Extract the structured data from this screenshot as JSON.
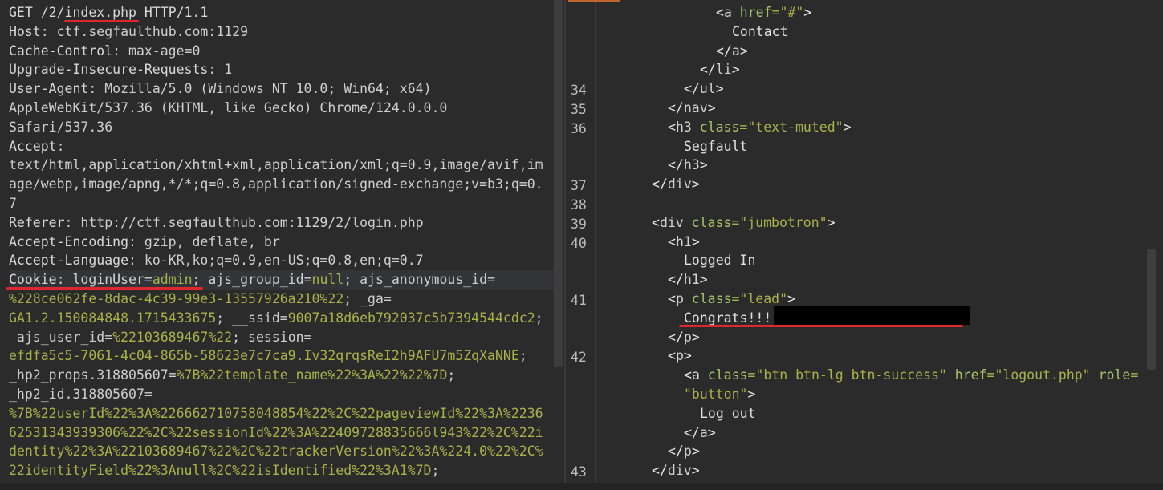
{
  "request": {
    "lines": [
      [
        {
          "t": "GET /2/",
          "c": "w"
        },
        {
          "t": "index.php",
          "c": "w"
        },
        {
          "t": " HTTP/1.1",
          "c": "w"
        }
      ],
      [
        {
          "t": "Host",
          "c": "k"
        },
        {
          "t": ": ctf.segfaulthub.com:1129",
          "c": "v"
        }
      ],
      [
        {
          "t": "Cache-Control",
          "c": "k"
        },
        {
          "t": ": max-age=0",
          "c": "v"
        }
      ],
      [
        {
          "t": "Upgrade-Insecure-Requests",
          "c": "k"
        },
        {
          "t": ": 1",
          "c": "v"
        }
      ],
      [
        {
          "t": "User-Agent",
          "c": "k"
        },
        {
          "t": ": Mozilla/5.0 (Windows NT 10.0; Win64; x64)",
          "c": "v"
        }
      ],
      [
        {
          "t": "AppleWebKit/537.36 (KHTML, like Gecko) Chrome/124.0.0.0",
          "c": "v"
        }
      ],
      [
        {
          "t": "Safari/537.36",
          "c": "v"
        }
      ],
      [
        {
          "t": "Accept",
          "c": "k"
        },
        {
          "t": ":",
          "c": "v"
        }
      ],
      [
        {
          "t": "text/html,application/xhtml+xml,application/xml;q=0.9,image/avif,im",
          "c": "v"
        }
      ],
      [
        {
          "t": "age/webp,image/apng,*/*;q=0.8,application/signed-exchange;v=b3;q=0.",
          "c": "v"
        }
      ],
      [
        {
          "t": "7",
          "c": "v"
        }
      ],
      [
        {
          "t": "Referer",
          "c": "k"
        },
        {
          "t": ": http://ctf.segfaulthub.com:1129/2/login.php",
          "c": "v"
        }
      ],
      [
        {
          "t": "Accept-Encoding",
          "c": "k"
        },
        {
          "t": ": gzip, deflate, br",
          "c": "v"
        }
      ],
      [
        {
          "t": "Accept-Language",
          "c": "k"
        },
        {
          "t": ": ko-KR,ko;q=0.9,en-US;q=0.8,en;q=0.7",
          "c": "v"
        }
      ],
      [
        {
          "t": "Cookie",
          "c": "k"
        },
        {
          "t": ": loginUser=",
          "c": "v"
        },
        {
          "t": "admin",
          "c": "g"
        },
        {
          "t": "; ajs_group_id=",
          "c": "v"
        },
        {
          "t": "null",
          "c": "g"
        },
        {
          "t": "; ajs_anonymous_id=",
          "c": "v"
        }
      ],
      [
        {
          "t": "%228ce062fe-8dac-4c39-99e3-13557926a210%22",
          "c": "g"
        },
        {
          "t": "; _ga=",
          "c": "v"
        }
      ],
      [
        {
          "t": "GA1.2.150084848.1715433675",
          "c": "g"
        },
        {
          "t": "; __ssid=",
          "c": "v"
        },
        {
          "t": "9007a18d6eb792037c5b7394544cdc2",
          "c": "g"
        },
        {
          "t": ";",
          "c": "v"
        }
      ],
      [
        {
          "t": " ajs_user_id=",
          "c": "v"
        },
        {
          "t": "%22103689467%22",
          "c": "g"
        },
        {
          "t": "; session=",
          "c": "v"
        }
      ],
      [
        {
          "t": "efdfa5c5-7061-4c04-865b-58623e7c7ca9.Iv32qrqsReI2h9AFU7m5ZqXaNNE",
          "c": "g"
        },
        {
          "t": ";",
          "c": "v"
        }
      ],
      [
        {
          "t": "_hp2_props.318805607=",
          "c": "v"
        },
        {
          "t": "%7B%22template_name%22%3A%22%22%7D",
          "c": "g"
        },
        {
          "t": ";",
          "c": "v"
        }
      ],
      [
        {
          "t": "_hp2_id.318805607=",
          "c": "v"
        }
      ],
      [
        {
          "t": "%7B%22userId%22%3A%226662710758048854%22%2C%22pageviewId%22%3A%2236",
          "c": "g"
        }
      ],
      [
        {
          "t": "62531343939306%22%2C%22sessionId%22%3A%22409728835666l943%22%2C%22i",
          "c": "g"
        }
      ],
      [
        {
          "t": "dentity%22%3A%22103689467%22%2C%22trackerVersion%22%3A%224.0%22%2C%",
          "c": "g"
        }
      ],
      [
        {
          "t": "22identityField%22%3Anull%2C%22isIdentified%22%3A1%7D",
          "c": "g"
        },
        {
          "t": ";",
          "c": "v"
        }
      ]
    ]
  },
  "response": {
    "lines": [
      {
        "ln": "",
        "indent": 7,
        "parts": [
          {
            "t": "<",
            "c": "tag"
          },
          {
            "t": "a",
            "c": "tn"
          },
          {
            "t": " href",
            "c": "an"
          },
          {
            "t": "=\"#\"",
            "c": "av"
          },
          {
            "t": ">",
            "c": "tag"
          }
        ]
      },
      {
        "ln": "",
        "indent": 8,
        "parts": [
          {
            "t": "Contact",
            "c": "txt"
          }
        ]
      },
      {
        "ln": "",
        "indent": 7,
        "parts": [
          {
            "t": "</",
            "c": "tag"
          },
          {
            "t": "a",
            "c": "tn"
          },
          {
            "t": ">",
            "c": "tag"
          }
        ]
      },
      {
        "ln": "",
        "indent": 6,
        "parts": [
          {
            "t": "</",
            "c": "tag"
          },
          {
            "t": "li",
            "c": "tn"
          },
          {
            "t": ">",
            "c": "tag"
          }
        ]
      },
      {
        "ln": "34",
        "indent": 5,
        "parts": [
          {
            "t": "</",
            "c": "tag"
          },
          {
            "t": "ul",
            "c": "tn"
          },
          {
            "t": ">",
            "c": "tag"
          }
        ]
      },
      {
        "ln": "35",
        "indent": 4,
        "parts": [
          {
            "t": "</",
            "c": "tag"
          },
          {
            "t": "nav",
            "c": "tn"
          },
          {
            "t": ">",
            "c": "tag"
          }
        ]
      },
      {
        "ln": "36",
        "indent": 4,
        "parts": [
          {
            "t": "<",
            "c": "tag"
          },
          {
            "t": "h3",
            "c": "tn"
          },
          {
            "t": " class",
            "c": "an"
          },
          {
            "t": "=\"text-muted\"",
            "c": "av"
          },
          {
            "t": ">",
            "c": "tag"
          }
        ]
      },
      {
        "ln": "",
        "indent": 5,
        "parts": [
          {
            "t": "Segfault",
            "c": "txt"
          }
        ]
      },
      {
        "ln": "",
        "indent": 4,
        "parts": [
          {
            "t": "</",
            "c": "tag"
          },
          {
            "t": "h3",
            "c": "tn"
          },
          {
            "t": ">",
            "c": "tag"
          }
        ]
      },
      {
        "ln": "37",
        "indent": 3,
        "parts": [
          {
            "t": "</",
            "c": "tag"
          },
          {
            "t": "div",
            "c": "tn"
          },
          {
            "t": ">",
            "c": "tag"
          }
        ]
      },
      {
        "ln": "38",
        "indent": 0,
        "parts": []
      },
      {
        "ln": "39",
        "indent": 3,
        "parts": [
          {
            "t": "<",
            "c": "tag"
          },
          {
            "t": "div",
            "c": "tn"
          },
          {
            "t": " class",
            "c": "an"
          },
          {
            "t": "=\"jumbotron\"",
            "c": "av"
          },
          {
            "t": ">",
            "c": "tag"
          }
        ]
      },
      {
        "ln": "40",
        "indent": 4,
        "parts": [
          {
            "t": "<",
            "c": "tag"
          },
          {
            "t": "h1",
            "c": "tn"
          },
          {
            "t": ">",
            "c": "tag"
          }
        ]
      },
      {
        "ln": "",
        "indent": 5,
        "parts": [
          {
            "t": "Logged In",
            "c": "txt"
          }
        ]
      },
      {
        "ln": "",
        "indent": 4,
        "parts": [
          {
            "t": "</",
            "c": "tag"
          },
          {
            "t": "h1",
            "c": "tn"
          },
          {
            "t": ">",
            "c": "tag"
          }
        ]
      },
      {
        "ln": "41",
        "indent": 4,
        "parts": [
          {
            "t": "<",
            "c": "tag"
          },
          {
            "t": "p",
            "c": "tn"
          },
          {
            "t": " class",
            "c": "an"
          },
          {
            "t": "=\"lead\"",
            "c": "av"
          },
          {
            "t": ">",
            "c": "tag"
          }
        ]
      },
      {
        "ln": "",
        "indent": 5,
        "parts": [
          {
            "t": "Congrats!!!",
            "c": "txt"
          }
        ]
      },
      {
        "ln": "",
        "indent": 4,
        "parts": [
          {
            "t": "</",
            "c": "tag"
          },
          {
            "t": "p",
            "c": "tn"
          },
          {
            "t": ">",
            "c": "tag"
          }
        ]
      },
      {
        "ln": "42",
        "indent": 4,
        "parts": [
          {
            "t": "<",
            "c": "tag"
          },
          {
            "t": "p",
            "c": "tn"
          },
          {
            "t": ">",
            "c": "tag"
          }
        ]
      },
      {
        "ln": "",
        "indent": 5,
        "parts": [
          {
            "t": "<",
            "c": "tag"
          },
          {
            "t": "a",
            "c": "tn"
          },
          {
            "t": " class",
            "c": "an"
          },
          {
            "t": "=\"btn btn-lg btn-success\"",
            "c": "av"
          },
          {
            "t": " href",
            "c": "an"
          },
          {
            "t": "=\"logout.php\"",
            "c": "av"
          },
          {
            "t": " role",
            "c": "an"
          },
          {
            "t": "=",
            "c": "av"
          }
        ]
      },
      {
        "ln": "",
        "indent": 5,
        "parts": [
          {
            "t": "\"button\"",
            "c": "av"
          },
          {
            "t": ">",
            "c": "tag"
          }
        ]
      },
      {
        "ln": "",
        "indent": 6,
        "parts": [
          {
            "t": "Log out",
            "c": "txt"
          }
        ]
      },
      {
        "ln": "",
        "indent": 5,
        "parts": [
          {
            "t": "</",
            "c": "tag"
          },
          {
            "t": "a",
            "c": "tn"
          },
          {
            "t": ">",
            "c": "tag"
          }
        ]
      },
      {
        "ln": "",
        "indent": 4,
        "parts": [
          {
            "t": "</",
            "c": "tag"
          },
          {
            "t": "p",
            "c": "tn"
          },
          {
            "t": ">",
            "c": "tag"
          }
        ]
      },
      {
        "ln": "43",
        "indent": 3,
        "parts": [
          {
            "t": "</",
            "c": "tag"
          },
          {
            "t": "div",
            "c": "tn"
          },
          {
            "t": ">",
            "c": "tag"
          }
        ]
      }
    ]
  }
}
